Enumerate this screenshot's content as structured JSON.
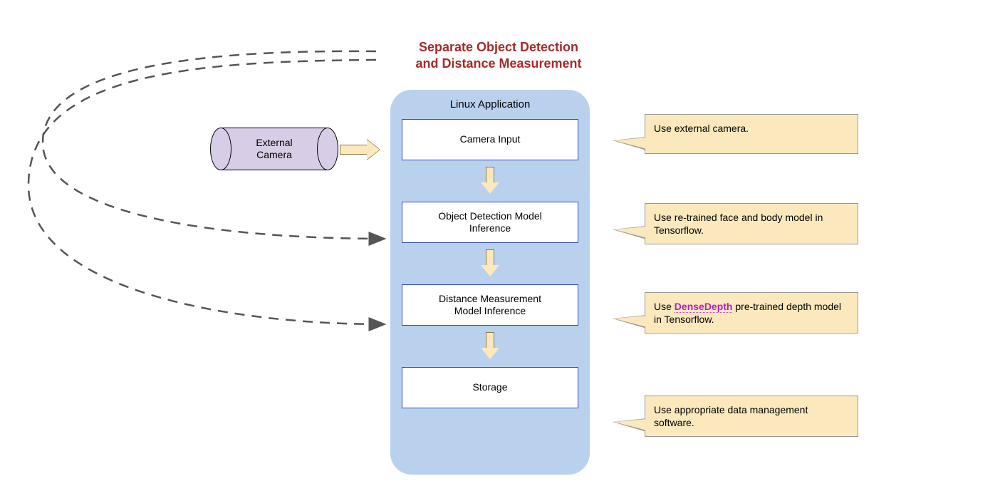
{
  "title": {
    "line1": "Separate Object Detection",
    "line2": "and Distance Measurement"
  },
  "external_camera": {
    "label_line1": "External",
    "label_line2": "Camera"
  },
  "app": {
    "title": "Linux Application",
    "steps": {
      "camera_input": "Camera Input",
      "object_detection_line1": "Object Detection Model",
      "object_detection_line2": "Inference",
      "distance_line1": "Distance Measurement",
      "distance_line2": "Model Inference",
      "storage": "Storage"
    }
  },
  "callouts": {
    "camera": "Use external camera.",
    "object_detection_pre": "Use re-trained face and body model in Tensorflow.",
    "distance_pre": "Use ",
    "distance_link": "DenseDepth",
    "distance_post": " pre-trained depth model in Tensorflow.",
    "storage": "Use appropriate data management software."
  },
  "colors": {
    "title": "#A62A29",
    "container_bg": "#BAD1EE",
    "box_border": "#2D48C9",
    "callout_bg": "#FBE9BD",
    "cylinder_bg": "#D8CDE6",
    "link": "#B31FBF"
  }
}
